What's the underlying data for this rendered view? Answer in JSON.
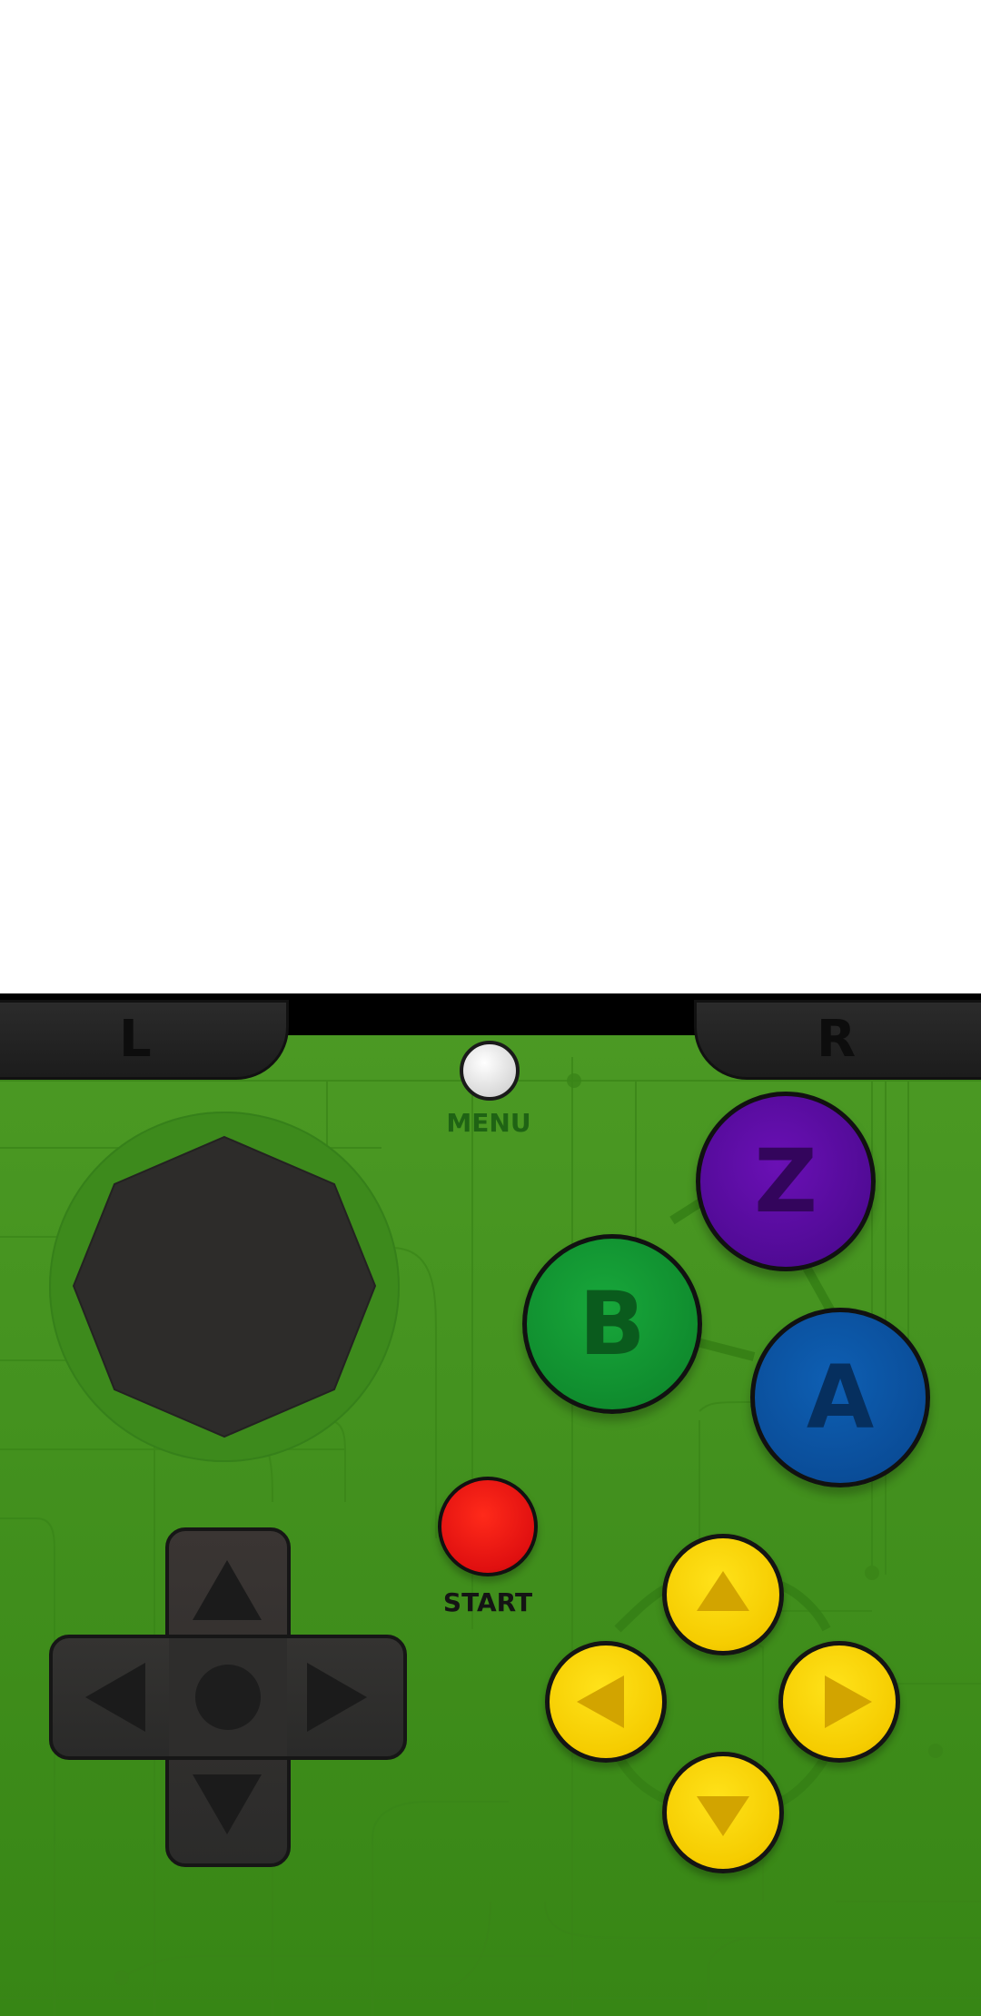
{
  "controller": {
    "shoulder_left": "L",
    "shoulder_right": "R",
    "menu_label": "MENU",
    "start_label": "START",
    "face_buttons": {
      "z": "Z",
      "b": "B",
      "a": "A"
    },
    "colors": {
      "background": "#44921f",
      "z_button": "#5a0ca3",
      "b_button": "#12a035",
      "a_button": "#0b55a6",
      "start_button": "#e51414",
      "c_buttons": "#f7cf00",
      "menu_button": "#e6e6e6",
      "dpad": "#2e2d2c"
    },
    "icons": {
      "dpad": [
        "arrow-up-icon",
        "arrow-down-icon",
        "arrow-left-icon",
        "arrow-right-icon"
      ],
      "c_buttons": [
        "c-up-icon",
        "c-left-icon",
        "c-right-icon",
        "c-down-icon"
      ]
    }
  }
}
